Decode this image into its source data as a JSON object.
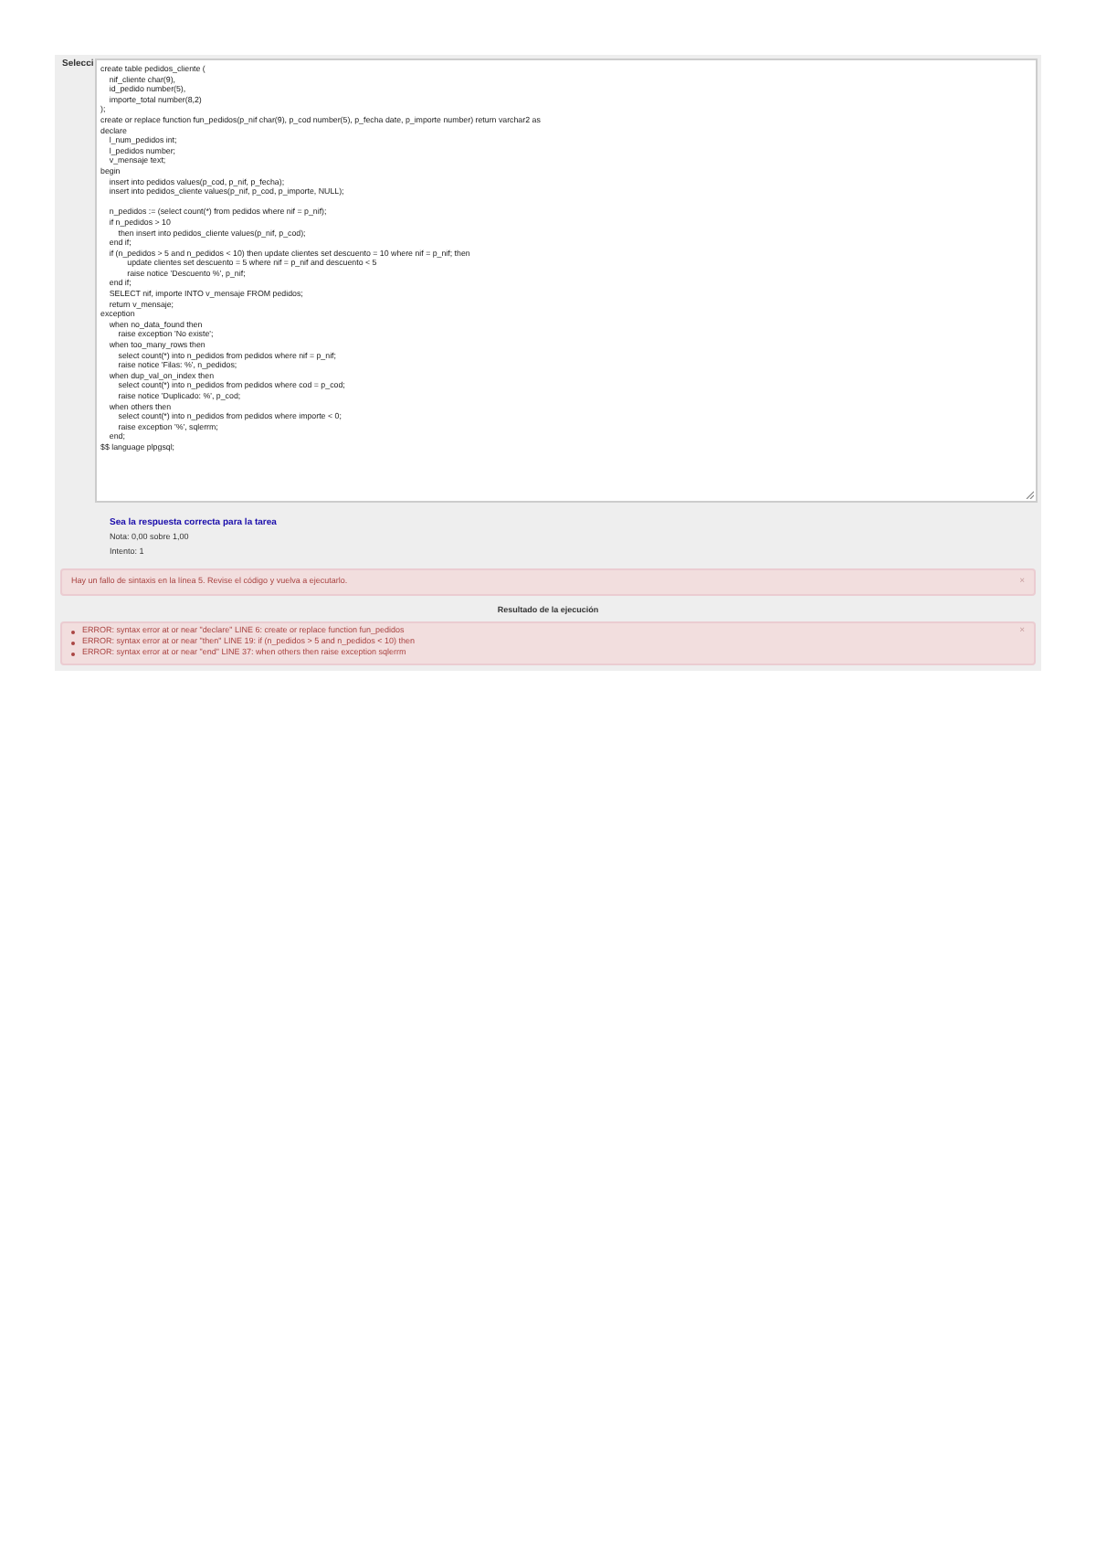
{
  "label": "Selecci",
  "code_lines": [
    {
      "text": "create table pedidos_cliente ("
    },
    {
      "text": "    nif_cliente char(9),"
    },
    {
      "text": "    id_pedido number(5),"
    },
    {
      "text": "    importe_total number(8,2)"
    },
    {
      "text": ");"
    },
    {
      "text": "create or replace function fun_pedidos(p_nif char(9), p_cod number(5), p_fecha date, p_importe number) return varchar2 as"
    },
    {
      "text": "declare"
    },
    {
      "text": "    l_num_pedidos int;"
    },
    {
      "text": "    l_pedidos number;"
    },
    {
      "text": "    v_mensaje text;"
    },
    {
      "text": "begin"
    },
    {
      "text": "    insert into pedidos values(p_cod, p_nif, p_fecha);"
    },
    {
      "text": "    insert into pedidos_cliente values(p_nif, p_cod, p_importe, NULL);"
    },
    {
      "text": "    n_pedidos := (select count(*) from pedidos where nif = p_nif);",
      "blank_before": true
    },
    {
      "text": "    if n_pedidos > 10"
    },
    {
      "text": "        then insert into pedidos_cliente values(p_nif, p_cod);"
    },
    {
      "text": "    end if;"
    },
    {
      "text": "    if (n_pedidos > 5 and n_pedidos < 10) then update clientes set descuento = 10 where nif = p_nif; then"
    },
    {
      "text": "            update clientes set descuento = 5 where nif = p_nif and descuento < 5"
    },
    {
      "text": "            raise notice 'Descuento %', p_nif;"
    },
    {
      "text": "    end if;"
    },
    {
      "text": "    SELECT nif, importe INTO v_mensaje FROM pedidos;"
    },
    {
      "text": "    return v_mensaje;"
    },
    {
      "text": "exception"
    },
    {
      "text": "    when no_data_found then"
    },
    {
      "text": "        raise exception 'No existe';"
    },
    {
      "text": "    when too_many_rows then"
    },
    {
      "text": "        select count(*) into n_pedidos from pedidos where nif = p_nif;"
    },
    {
      "text": "        raise notice 'Filas: %', n_pedidos;"
    },
    {
      "text": "    when dup_val_on_index then"
    },
    {
      "text": "        select count(*) into n_pedidos from pedidos where cod = p_cod;"
    },
    {
      "text": "        raise notice 'Duplicado: %', p_cod;"
    },
    {
      "text": "    when others then"
    },
    {
      "text": "        select count(*) into n_pedidos from pedidos where importe < 0;"
    },
    {
      "text": "        raise exception '%', sqlerrm;"
    },
    {
      "text": "    end;"
    },
    {
      "text": "$$ language plpgsql;"
    }
  ],
  "feedback": {
    "link": "Sea la respuesta correcta para la tarea",
    "lines": [
      "Nota: 0,00 sobre 1,00",
      "Intento: 1"
    ]
  },
  "alert": {
    "message": "Hay un fallo de sintaxis en la línea 5. Revise el código y vuelva a ejecutarlo.",
    "close": "×"
  },
  "result_heading": "Resultado de la ejecución",
  "errors": {
    "close": "×",
    "items": [
      "ERROR: syntax error at or near \"declare\" LINE 6: create or replace function fun_pedidos",
      "ERROR: syntax error at or near \"then\" LINE 19: if (n_pedidos > 5 and n_pedidos < 10) then",
      "ERROR: syntax error at or near \"end\" LINE 37: when others then raise exception sqlerrm"
    ]
  }
}
